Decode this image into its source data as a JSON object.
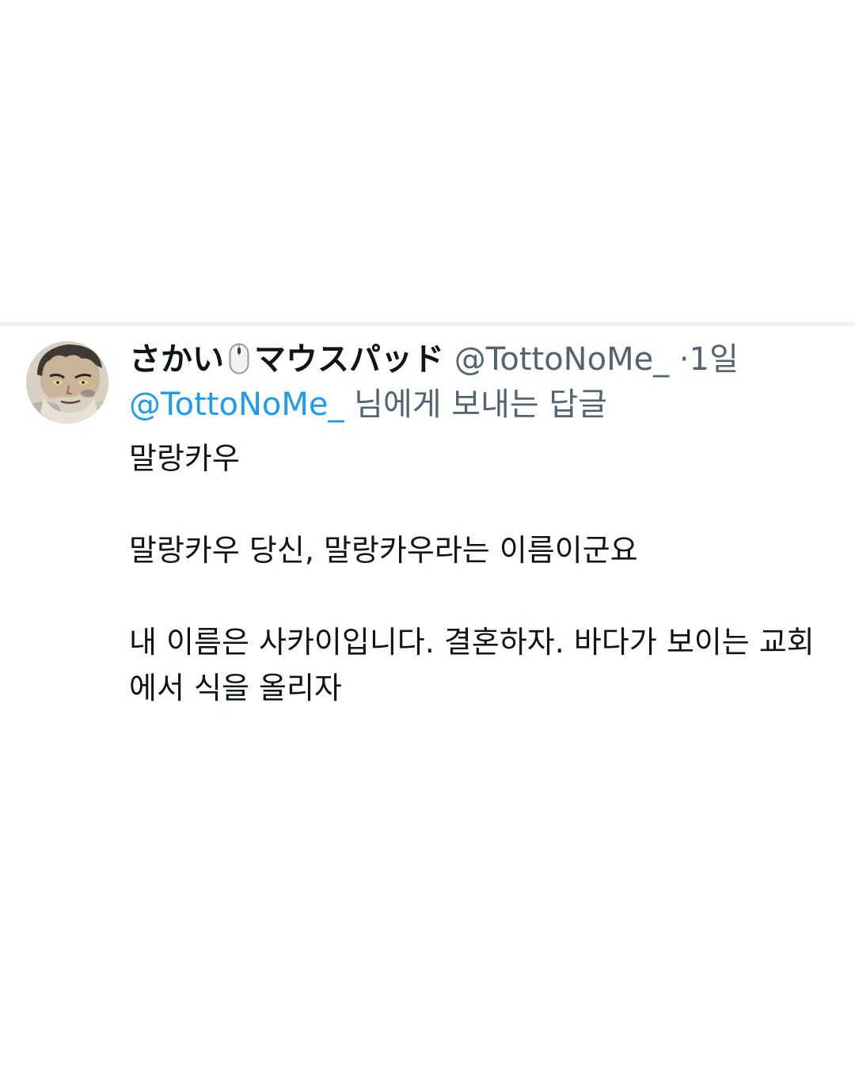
{
  "tweet": {
    "display_name": "さかい",
    "display_name_suffix": "マウスパッド",
    "emoji_icon": "computer-mouse-icon",
    "handle": "@TottoNoMe_",
    "separator": "·",
    "time": "1일",
    "reply_to_handle": "@TottoNoMe_",
    "reply_suffix": " 님에게 보내는 답글",
    "paragraphs": [
      "말랑카우",
      "말랑카우 당신, 말랑카우라는 이름이군요",
      "내 이름은 사카이입니다. 결혼하자. 바다가 보이는 교회에서 식을 올리자"
    ]
  },
  "colors": {
    "text_primary": "#0f1419",
    "text_secondary": "#536471",
    "link": "#1d9bf0"
  }
}
